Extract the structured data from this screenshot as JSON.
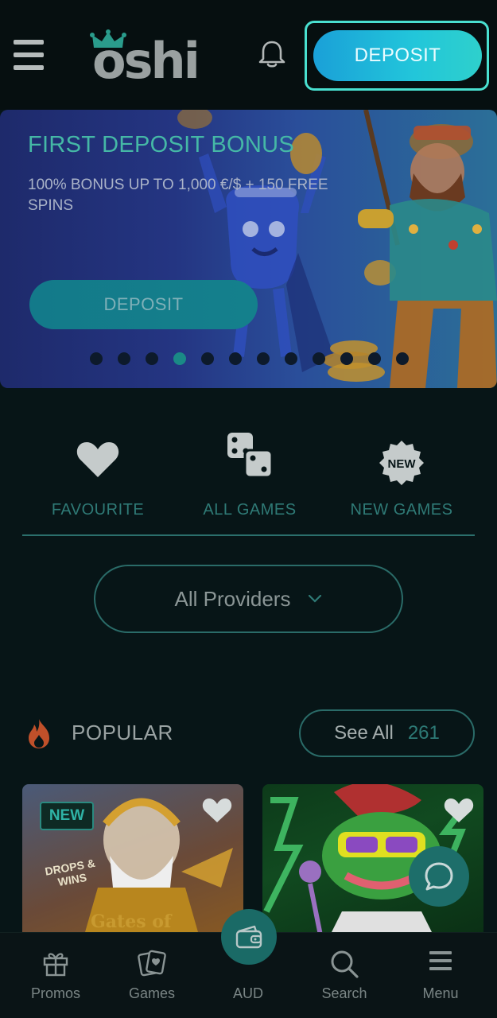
{
  "header": {
    "logo_text": "oshi",
    "deposit_label": "DEPOSIT"
  },
  "banner": {
    "title": "FIRST DEPOSIT BONUS",
    "subtitle": "100% BONUS UP TO 1,000 €/$ + 150 FREE SPINS",
    "deposit_label": "DEPOSIT",
    "slide_count": 12,
    "active_slide": 4
  },
  "categories": [
    {
      "label": "FAVOURITE",
      "icon": "heart-icon"
    },
    {
      "label": "ALL GAMES",
      "icon": "dice-icon"
    },
    {
      "label": "NEW GAMES",
      "icon": "new-badge-icon",
      "icon_text": "NEW"
    }
  ],
  "providers": {
    "label": "All Providers"
  },
  "popular": {
    "title": "POPULAR",
    "see_all_label": "See All",
    "count": "261"
  },
  "games": [
    {
      "badge": "NEW",
      "drops_text": "DROPS & WINS",
      "title_partial": "Gates of"
    },
    {
      "badge": ""
    }
  ],
  "bottom_nav": [
    {
      "label": "Promos",
      "icon": "gift-icon"
    },
    {
      "label": "Games",
      "icon": "cards-icon"
    },
    {
      "label": "AUD",
      "icon": "wallet-icon"
    },
    {
      "label": "Search",
      "icon": "search-icon"
    },
    {
      "label": "Menu",
      "icon": "menu-icon"
    }
  ],
  "colors": {
    "accent": "#45b8a6",
    "background": "#071517",
    "deposit_gradient_start": "#1aa0d8",
    "deposit_gradient_end": "#2ed0cc"
  }
}
